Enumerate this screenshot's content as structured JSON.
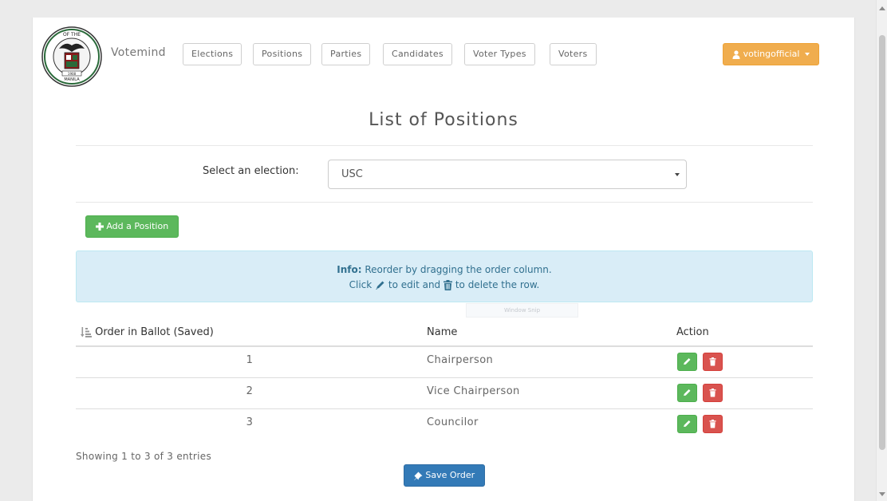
{
  "navbar": {
    "brand": "Votemind",
    "items": [
      {
        "label": "Elections"
      },
      {
        "label": "Positions"
      },
      {
        "label": "Parties"
      },
      {
        "label": "Candidates"
      },
      {
        "label": "Voter Types"
      },
      {
        "label": "Voters"
      }
    ],
    "user": "votingofficial",
    "logo_text": [
      "OF THE",
      "MANILA",
      "1908"
    ]
  },
  "page": {
    "title": "List of Positions"
  },
  "election_select": {
    "label": "Select an election:",
    "selected": "USC"
  },
  "add_button": "Add a Position",
  "info": {
    "prefix": "Info:",
    "line1": "Reorder by dragging the order column.",
    "line2_a": "Click",
    "line2_b": "to edit and",
    "line2_c": "to delete the row."
  },
  "overlay": {
    "snip": "Window Snip"
  },
  "table": {
    "headers": {
      "order": "Order in Ballot (Saved)",
      "name": "Name",
      "action": "Action"
    },
    "rows": [
      {
        "order": "1",
        "name": "Chairperson"
      },
      {
        "order": "2",
        "name": "Vice Chairperson"
      },
      {
        "order": "3",
        "name": "Councilor"
      }
    ]
  },
  "footer": {
    "showing": "Showing 1 to 3 of 3 entries",
    "save_button": "Save Order"
  },
  "colors": {
    "success": "#5cb85c",
    "danger": "#d9534f",
    "warning": "#f0ad4e",
    "primary": "#337ab7",
    "info_bg": "#d9edf7",
    "info_text": "#31708f",
    "seal_red": "#8b1a1a"
  }
}
